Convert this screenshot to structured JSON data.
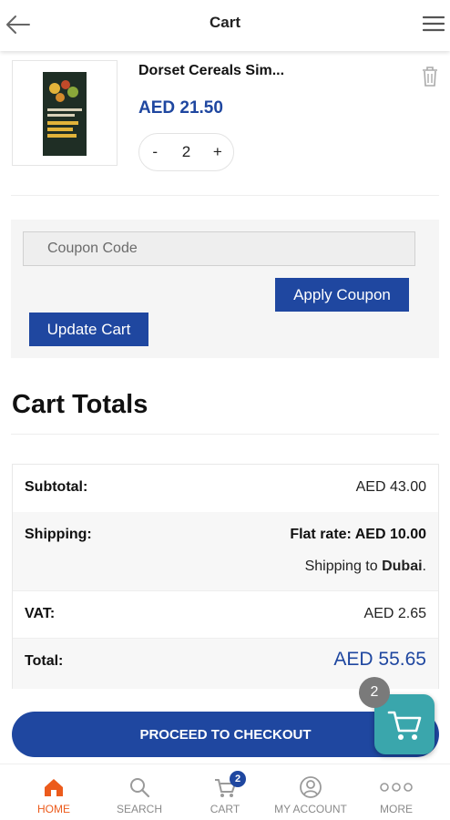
{
  "header": {
    "title": "Cart",
    "back_icon": "arrow-left-icon",
    "menu_icon": "hamburger-menu-icon"
  },
  "product": {
    "name": "Dorset Cereals Sim...",
    "price": "AED 21.50",
    "quantity": "2",
    "minus": "-",
    "plus": "+",
    "image_text": "dorset cereals simply fruit muesli"
  },
  "coupon": {
    "placeholder": "Coupon Code",
    "apply_label": "Apply Coupon",
    "update_label": "Update Cart"
  },
  "totals": {
    "title": "Cart Totals",
    "subtotal_label": "Subtotal:",
    "subtotal_value": "AED 43.00",
    "shipping_label": "Shipping:",
    "shipping_value": "Flat rate: AED 10.00",
    "shipping_to_prefix": "Shipping to",
    "shipping_to_place": "Dubai",
    "shipping_to_suffix": ".",
    "vat_label": "VAT:",
    "vat_value": "AED 2.65",
    "total_label": "Total:",
    "total_value": "AED 55.65"
  },
  "checkout_label": "PROCEED TO CHECKOUT",
  "floating_cart": {
    "count": "2"
  },
  "nav": {
    "items": [
      {
        "label": "HOME",
        "icon": "home-icon",
        "active": true
      },
      {
        "label": "SEARCH",
        "icon": "search-icon",
        "active": false
      },
      {
        "label": "CART",
        "icon": "cart-icon",
        "active": false,
        "badge": "2"
      },
      {
        "label": "MY ACCOUNT",
        "icon": "account-icon",
        "active": false
      },
      {
        "label": "MORE",
        "icon": "more-icon",
        "active": false
      }
    ]
  },
  "colors": {
    "primary": "#1f47a0",
    "accent": "#ec5b1c",
    "float_cart": "#3aa6ac"
  }
}
